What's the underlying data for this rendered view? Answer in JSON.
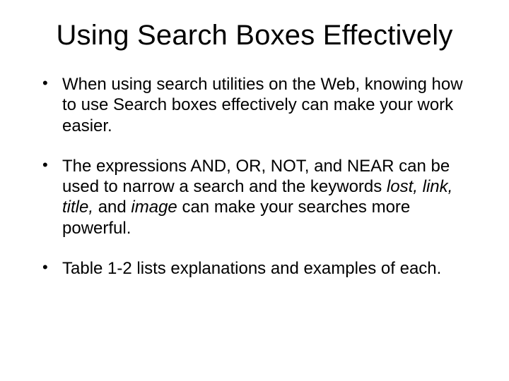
{
  "title": "Using Search Boxes Effectively",
  "bullets": {
    "b1": "When using search utilities on the Web, knowing how to use Search boxes effectively can make your work easier.",
    "b2": {
      "p1": "The expressions AND, OR, NOT, and NEAR can be used to narrow a search and the keywords ",
      "i1": "lost, link, title, ",
      "p2": "and ",
      "i2": "image ",
      "p3": "can make your searches more powerful."
    },
    "b3": "Table 1-2 lists explanations and examples of each."
  }
}
